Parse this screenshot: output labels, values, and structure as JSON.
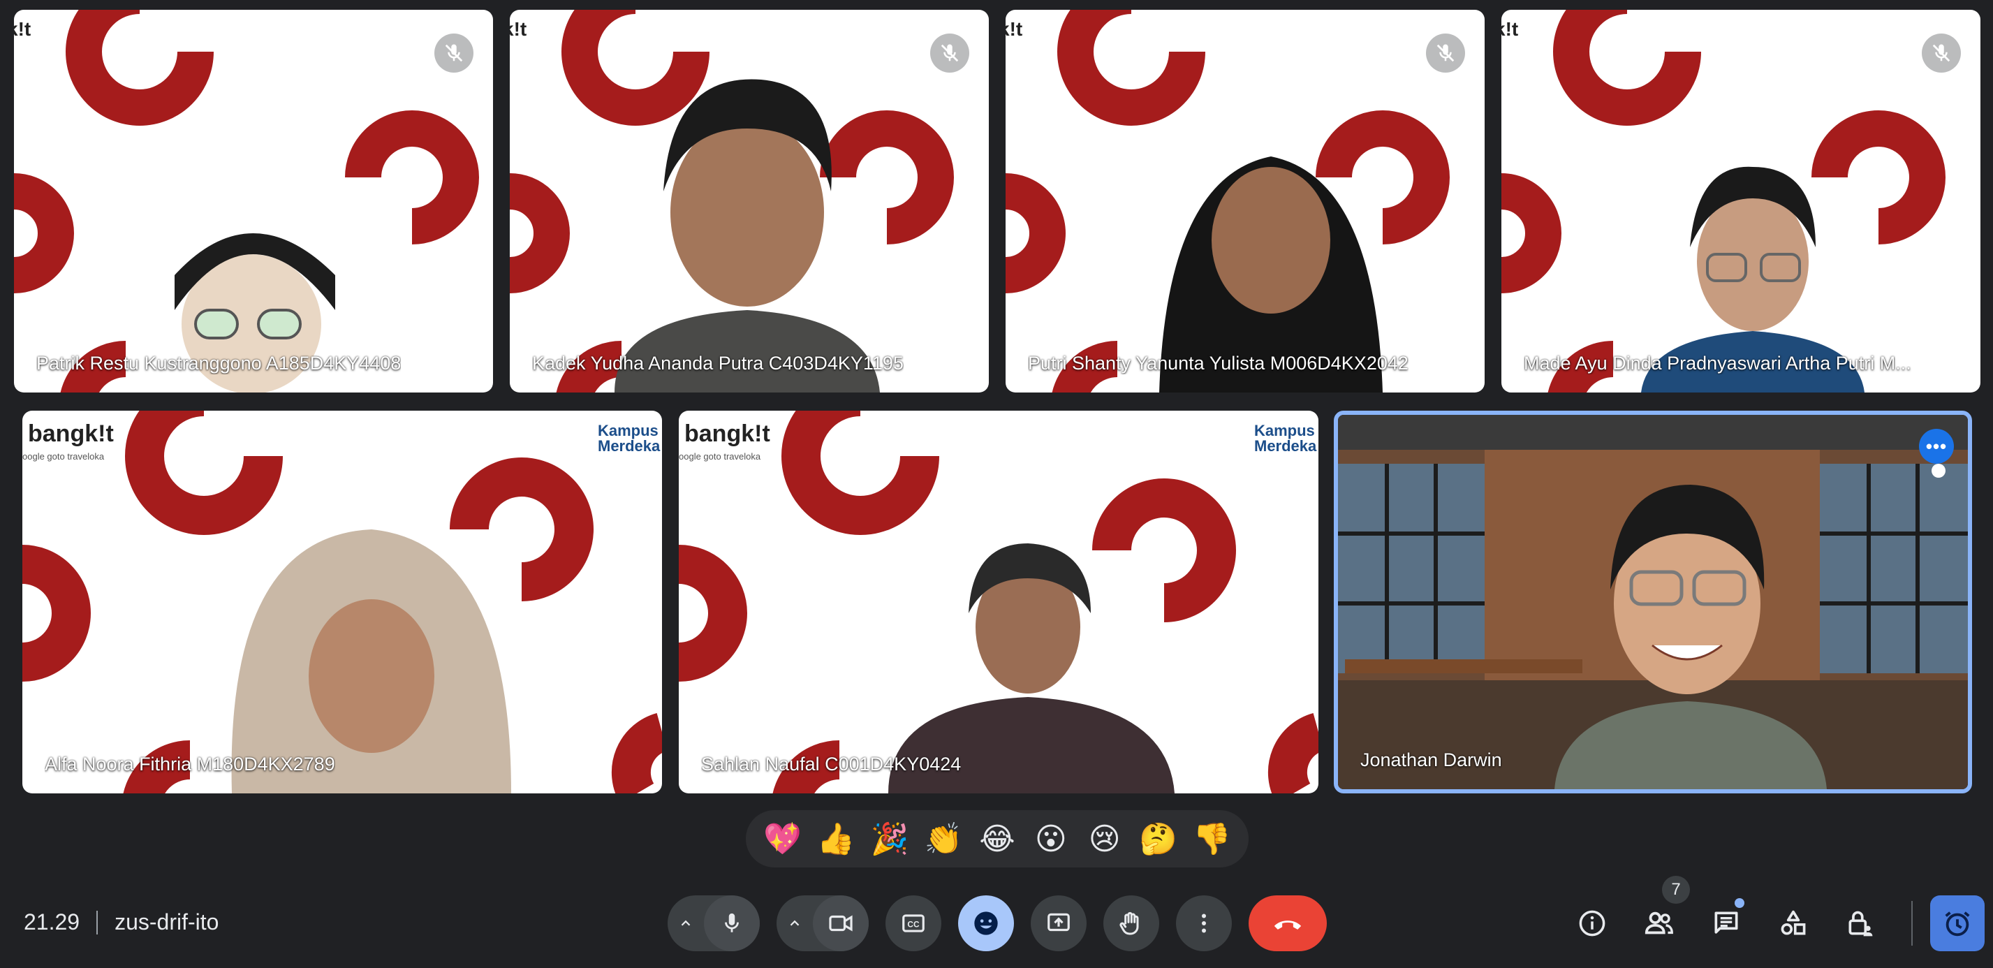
{
  "participants_top": [
    {
      "name": "Patrik Restu Kustranggono A185D4KY4408",
      "muted": true
    },
    {
      "name": "Kadek Yudha Ananda Putra C403D4KY1195",
      "muted": true
    },
    {
      "name": "Putri Shanty Yanunta Yulista M006D4KX2042",
      "muted": true
    },
    {
      "name": "Made Ayu Dinda Pradnyaswari Artha Putri M...",
      "muted": true
    }
  ],
  "participants_bottom": [
    {
      "name": "Alfa Noora Fithria M180D4KX2789"
    },
    {
      "name": "Sahlan Naufal C001D4KY0424"
    },
    {
      "name": "Jonathan Darwin"
    }
  ],
  "branding": {
    "logo_text": "bangk!t",
    "logo_sub": "oogle  goto  traveloka",
    "partner_text": "Kampus Merdeka",
    "edge_text": "k!t"
  },
  "reactions": [
    "💖",
    "👍",
    "🎉",
    "👏",
    "😂",
    "😮",
    "😢",
    "🤔",
    "👎"
  ],
  "meeting": {
    "time": "21.29",
    "code": "zus-drif-ito"
  },
  "controls": {
    "mic": "mic-icon",
    "camera": "camera-icon",
    "captions": "CC",
    "emoji": "emoji-icon",
    "present": "present-icon",
    "raise_hand": "hand-icon",
    "more": "more-vert-icon",
    "end_call": "end-call-icon"
  },
  "right_panel": {
    "people_count": "7"
  },
  "colors": {
    "background": "#202124",
    "accent": "#8ab4f8",
    "end_call": "#ea4335",
    "brand_red": "#a51c1c"
  }
}
